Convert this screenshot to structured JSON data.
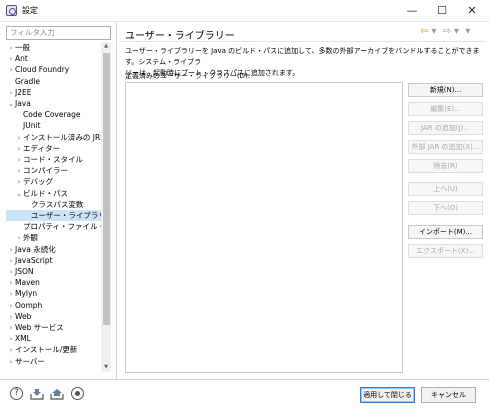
{
  "window": {
    "title": "設定",
    "minimize": "—",
    "maximize": "☐",
    "close": "✕"
  },
  "filter": {
    "placeholder": "フィルタ入力"
  },
  "tree": {
    "items": [
      {
        "label": "一般",
        "twisty": "›",
        "indent": 0
      },
      {
        "label": "Ant",
        "twisty": "›",
        "indent": 0
      },
      {
        "label": "Cloud Foundry",
        "twisty": "›",
        "indent": 0
      },
      {
        "label": "Gradle",
        "twisty": "",
        "indent": 0
      },
      {
        "label": "J2EE",
        "twisty": "›",
        "indent": 0
      },
      {
        "label": "Java",
        "twisty": "⌄",
        "indent": 0
      },
      {
        "label": "Code Coverage",
        "twisty": "",
        "indent": 1
      },
      {
        "label": "JUnit",
        "twisty": "",
        "indent": 1
      },
      {
        "label": "インストール済みの JRE",
        "twisty": "›",
        "indent": 1
      },
      {
        "label": "エディター",
        "twisty": "›",
        "indent": 1
      },
      {
        "label": "コード・スタイル",
        "twisty": "›",
        "indent": 1
      },
      {
        "label": "コンパイラー",
        "twisty": "›",
        "indent": 1
      },
      {
        "label": "デバッグ",
        "twisty": "›",
        "indent": 1
      },
      {
        "label": "ビルド・パス",
        "twisty": "⌄",
        "indent": 1
      },
      {
        "label": "クラスパス変数",
        "twisty": "",
        "indent": 2
      },
      {
        "label": "ユーザー・ライブラリー",
        "twisty": "",
        "indent": 2,
        "selected": true
      },
      {
        "label": "プロパティ・ファイル・エディ",
        "twisty": "",
        "indent": 1
      },
      {
        "label": "外観",
        "twisty": "›",
        "indent": 1
      },
      {
        "label": "Java 永続化",
        "twisty": "›",
        "indent": 0
      },
      {
        "label": "JavaScript",
        "twisty": "›",
        "indent": 0
      },
      {
        "label": "JSON",
        "twisty": "›",
        "indent": 0
      },
      {
        "label": "Maven",
        "twisty": "›",
        "indent": 0
      },
      {
        "label": "Mylyn",
        "twisty": "›",
        "indent": 0
      },
      {
        "label": "Oomph",
        "twisty": "›",
        "indent": 0
      },
      {
        "label": "Web",
        "twisty": "›",
        "indent": 0
      },
      {
        "label": "Web サービス",
        "twisty": "›",
        "indent": 0
      },
      {
        "label": "XML",
        "twisty": "›",
        "indent": 0
      },
      {
        "label": "インストール/更新",
        "twisty": "›",
        "indent": 0
      },
      {
        "label": "サーバー",
        "twisty": "›",
        "indent": 0
      }
    ]
  },
  "page": {
    "title": "ユーザー・ライブラリー",
    "description_line1": "ユーザー・ライブラリーを Java のビルド・パスに追加して、多数の外部アーカイブをバンドルすることができます。システム・ライブラ",
    "description_line2": "リーは、起動時にブート・クラスパスに追加されます。",
    "list_label": "定義済みのユーザー・ライブラリー(D):"
  },
  "buttons": [
    {
      "name": "new-button",
      "label": "新規(N)...",
      "enabled": true
    },
    {
      "name": "edit-button",
      "label": "編集(E)...",
      "enabled": false
    },
    {
      "name": "add-jar-button",
      "label": "JAR の追加(J)...",
      "enabled": false
    },
    {
      "name": "add-external-jar-button",
      "label": "外部 JAR の追加(X)...",
      "enabled": false
    },
    {
      "name": "remove-button",
      "label": "除去(R)",
      "enabled": false
    },
    {
      "name": "up-button",
      "label": "上へ(U)",
      "enabled": false
    },
    {
      "name": "down-button",
      "label": "下へ(O)",
      "enabled": false
    },
    {
      "name": "import-button",
      "label": "インポート(M)...",
      "enabled": true
    },
    {
      "name": "export-button",
      "label": "エクスポート(X)...",
      "enabled": false
    }
  ],
  "footer": {
    "apply_close": "適用して閉じる",
    "cancel": "キャンセル"
  },
  "icons": {
    "help": "?",
    "import": "import-preferences-icon",
    "export": "export-preferences-icon",
    "record": "record-icon",
    "back": "⇦",
    "forward": "⇨",
    "menu": "▾"
  },
  "colors": {
    "accent": "#2a7fd0",
    "selection": "#cce4f7",
    "nav_arrow": "#c49a2c"
  }
}
